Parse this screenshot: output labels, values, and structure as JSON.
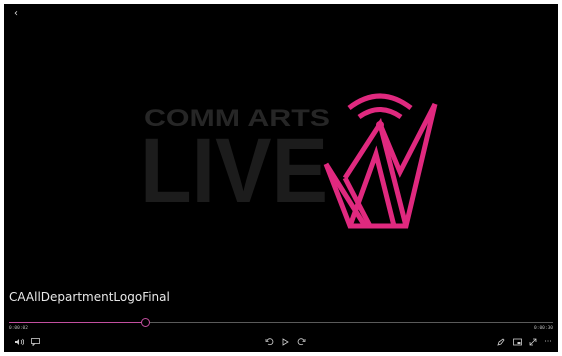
{
  "app": {
    "back_icon": "back-arrow-icon",
    "back_glyph": "‹"
  },
  "video": {
    "title": "CAAllDepartmentLogoFinal",
    "logo_top_text": "COMM ARTS",
    "logo_big_text": "LIVE",
    "brand_color": "#e0297f",
    "background_color": "#000000"
  },
  "playback": {
    "elapsed": "0:00:02",
    "total": "0:00:30",
    "progress_fraction": 0.25
  },
  "controls": {
    "left": [
      {
        "name": "volume-icon"
      },
      {
        "name": "captions-icon"
      }
    ],
    "center": [
      {
        "name": "skip-back-icon"
      },
      {
        "name": "play-icon"
      },
      {
        "name": "skip-forward-icon"
      }
    ],
    "right": [
      {
        "name": "edit-pencil-icon"
      },
      {
        "name": "mini-view-icon"
      },
      {
        "name": "fullscreen-icon"
      },
      {
        "name": "more-options-icon",
        "glyph": "···"
      }
    ]
  }
}
